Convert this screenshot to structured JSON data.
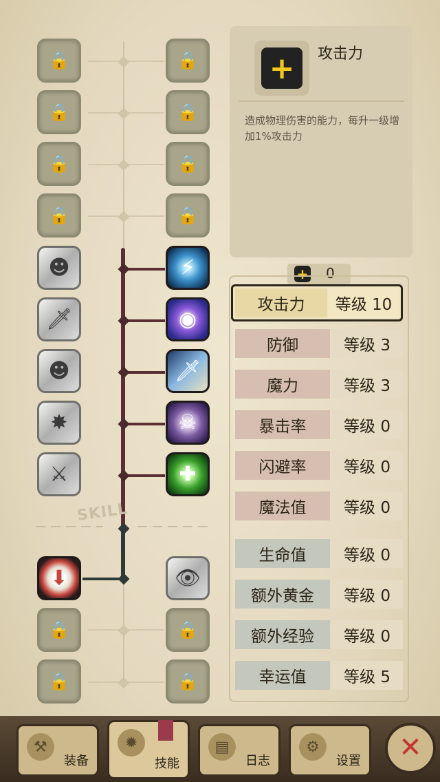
{
  "skill_tree": {
    "label": "SKILL",
    "left_column": [
      {
        "name": "locked",
        "state": "locked"
      },
      {
        "name": "locked",
        "state": "locked"
      },
      {
        "name": "locked",
        "state": "locked"
      },
      {
        "name": "locked",
        "state": "locked"
      },
      {
        "name": "skill",
        "state": "unlearned"
      },
      {
        "name": "skill",
        "state": "unlearned"
      },
      {
        "name": "skill",
        "state": "unlearned"
      },
      {
        "name": "skill",
        "state": "unlearned"
      },
      {
        "name": "skill",
        "state": "unlearned"
      },
      {
        "name": "skill",
        "state": "learned"
      },
      {
        "name": "locked",
        "state": "locked"
      },
      {
        "name": "locked",
        "state": "locked"
      }
    ],
    "right_column": [
      {
        "state": "locked"
      },
      {
        "state": "locked"
      },
      {
        "state": "locked"
      },
      {
        "state": "locked"
      },
      {
        "state": "learned",
        "color": "#2f6f9e"
      },
      {
        "state": "learned",
        "color": "#4a3a9e"
      },
      {
        "state": "learned",
        "color": "#3f6f9a"
      },
      {
        "state": "learned",
        "color": "#5a3a7a"
      },
      {
        "state": "learned",
        "color": "#3a7a2a"
      },
      {
        "state": "unlearned"
      },
      {
        "state": "locked"
      },
      {
        "state": "locked"
      }
    ]
  },
  "info_panel": {
    "icon": "+",
    "title": "攻击力",
    "description": "造成物理伤害的能力，每升一级增加1%攻击力"
  },
  "points": {
    "icon": "+",
    "value": "0"
  },
  "stats": [
    {
      "name": "攻击力",
      "level": "等级 10",
      "group": "selected"
    },
    {
      "name": "防御",
      "level": "等级 3",
      "group": "red"
    },
    {
      "name": "魔力",
      "level": "等级 3",
      "group": "red"
    },
    {
      "name": "暴击率",
      "level": "等级 0",
      "group": "red"
    },
    {
      "name": "闪避率",
      "level": "等级 0",
      "group": "red"
    },
    {
      "name": "魔法值",
      "level": "等级 0",
      "group": "red"
    },
    {
      "name": "生命值",
      "level": "等级 0",
      "group": "blue"
    },
    {
      "name": "额外黄金",
      "level": "等级 0",
      "group": "blue"
    },
    {
      "name": "额外经验",
      "level": "等级 0",
      "group": "blue"
    },
    {
      "name": "幸运值",
      "level": "等级 5",
      "group": "blue"
    }
  ],
  "nav": {
    "tabs": [
      {
        "label": "装备",
        "icon": "axe-icon"
      },
      {
        "label": "技能",
        "icon": "skill-icon"
      },
      {
        "label": "日志",
        "icon": "journal-icon"
      },
      {
        "label": "设置",
        "icon": "gear-icon"
      }
    ],
    "close_icon": "✕"
  },
  "colors": {
    "accent_yellow": "#f2c81c",
    "active_path": "#5b2f32",
    "close_red": "#c2362f"
  }
}
